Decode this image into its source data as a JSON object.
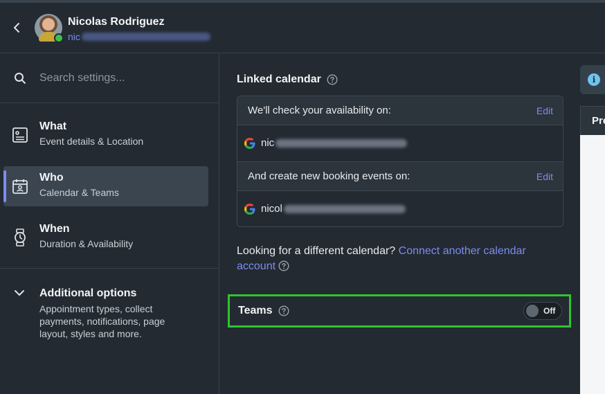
{
  "user": {
    "name": "Nicolas Rodriguez",
    "email_visible": "nic"
  },
  "search": {
    "placeholder": "Search settings..."
  },
  "nav": {
    "items": [
      {
        "title": "What",
        "subtitle": "Event details & Location",
        "icon": "document-icon",
        "active": false
      },
      {
        "title": "Who",
        "subtitle": "Calendar & Teams",
        "icon": "calendar-person-icon",
        "active": true
      },
      {
        "title": "When",
        "subtitle": "Duration & Availability",
        "icon": "watch-icon",
        "active": false
      }
    ],
    "additional": {
      "title": "Additional options",
      "subtitle": "Appointment types, collect payments, notifications, page layout, styles and more."
    }
  },
  "linked_calendar": {
    "title": "Linked calendar",
    "check_label": "We'll check your availability on:",
    "check_edit": "Edit",
    "check_account_visible": "nic",
    "create_label": "And create new booking events on:",
    "create_edit": "Edit",
    "create_account_visible": "nicol"
  },
  "looking": {
    "text": "Looking for a different calendar?",
    "link": "Connect another calendar account"
  },
  "teams": {
    "title": "Teams",
    "toggle_label": "Off",
    "enabled": false
  },
  "preview": {
    "header_visible": "Pre"
  },
  "colors": {
    "accent": "#7c8cf2",
    "highlight": "#2ec52e",
    "background": "#232a31",
    "status_online": "#3fbf4c"
  }
}
